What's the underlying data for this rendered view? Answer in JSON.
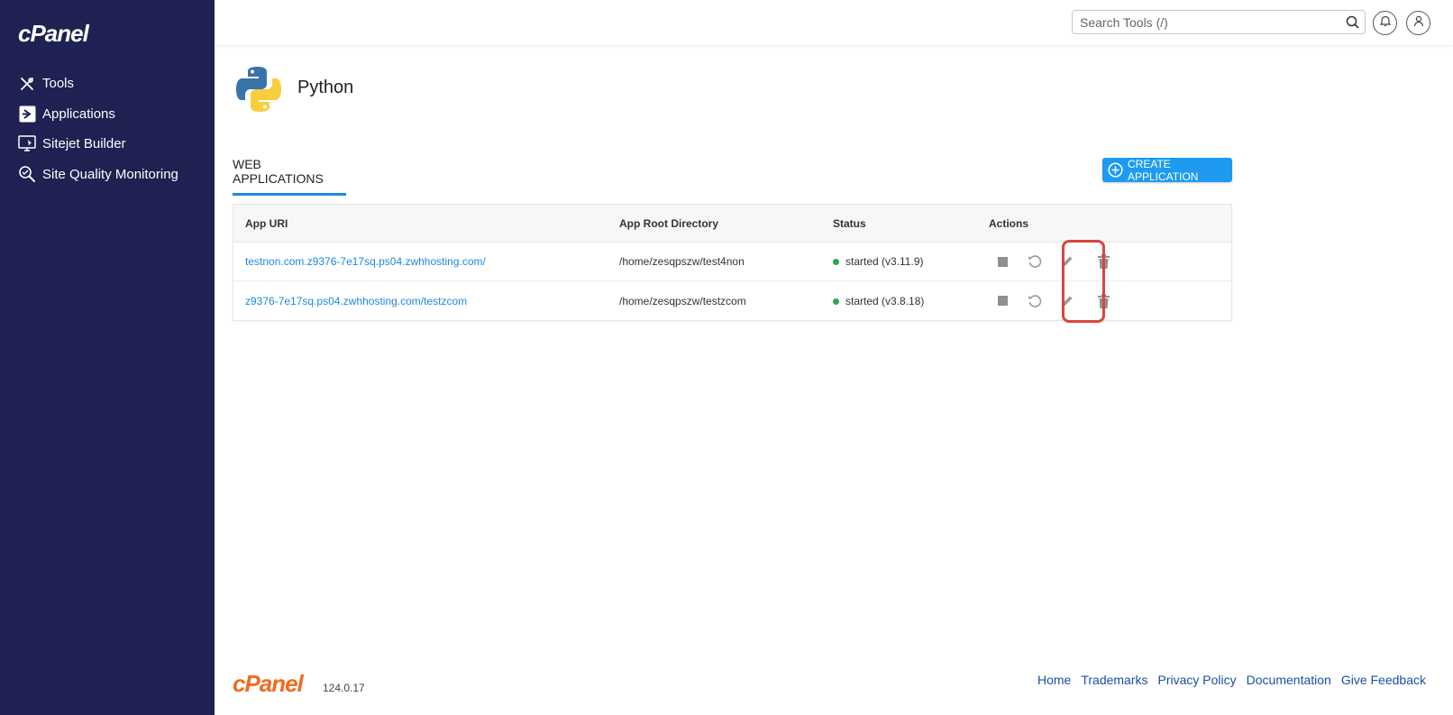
{
  "sidebar": {
    "logo": "cPanel",
    "items": [
      {
        "label": "Tools",
        "icon": "tools-icon"
      },
      {
        "label": "Applications",
        "icon": "applications-icon"
      },
      {
        "label": "Sitejet Builder",
        "icon": "sitejet-icon"
      },
      {
        "label": "Site Quality Monitoring",
        "icon": "site-quality-icon"
      }
    ]
  },
  "header": {
    "search_placeholder": "Search Tools (/)",
    "icons": [
      "search-icon",
      "bell-icon",
      "user-icon"
    ]
  },
  "page": {
    "title": "Python",
    "tab": "WEB APPLICATIONS",
    "create_label": "CREATE APPLICATION"
  },
  "table": {
    "headers": [
      "App URI",
      "App Root Directory",
      "Status",
      "Actions"
    ],
    "rows": [
      {
        "uri": "testnon.com.z9376-7e17sq.ps04.zwhhosting.com/",
        "root": "/home/zesqpszw/test4non",
        "status": "started (v3.11.9)"
      },
      {
        "uri": "z9376-7e17sq.ps04.zwhhosting.com/testzcom",
        "root": "/home/zesqpszw/testzcom",
        "status": "started (v3.8.18)"
      }
    ]
  },
  "footer": {
    "logo": "cPanel",
    "version": "124.0.17",
    "links": [
      "Home",
      "Trademarks",
      "Privacy Policy",
      "Documentation",
      "Give Feedback"
    ]
  },
  "colors": {
    "sidebar_bg": "#1f2152",
    "accent": "#1e9bf0",
    "link": "#1e88e5",
    "status_ok": "#2ea44f",
    "highlight": "#d9463e",
    "footer_logo": "#f26b21"
  }
}
